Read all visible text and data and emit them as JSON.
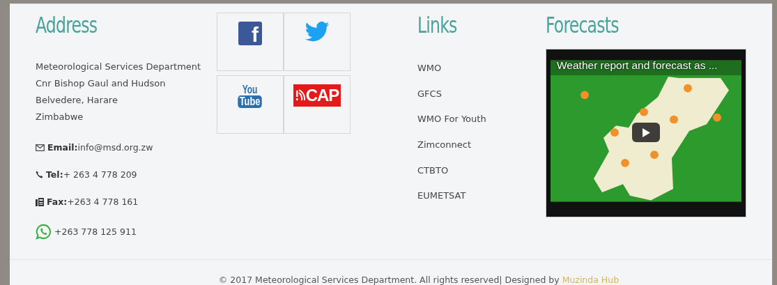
{
  "address": {
    "title": "Address",
    "lines": [
      "Meteorological Services Department",
      "Cnr Bishop Gaul and Hudson",
      "Belvedere, Harare",
      "Zimbabwe"
    ],
    "contacts": [
      {
        "kind": "email",
        "label": "Email:",
        "value": "info@msd.org.zw"
      },
      {
        "kind": "phone",
        "label": "Tel:",
        "value": "+ 263 4 778 209"
      },
      {
        "kind": "fax",
        "label": "Fax:",
        "value": "+263 4 778 161"
      },
      {
        "kind": "whatsapp",
        "value": "+263 778 125 911"
      }
    ]
  },
  "social": [
    {
      "kind": "facebook",
      "text": "f"
    },
    {
      "kind": "twitter"
    },
    {
      "kind": "youtube",
      "text": "You",
      "text2": "Tube"
    },
    {
      "kind": "cap",
      "text": "CAP"
    }
  ],
  "links": {
    "title": "Links",
    "items": [
      "WMO",
      "GFCS",
      "WMO For Youth",
      "Zimconnect",
      "CTBTO",
      "EUMETSAT"
    ]
  },
  "forecasts": {
    "title": "Forecasts",
    "video_title": "Weather report and forecast as ..."
  },
  "footer": {
    "text": "© 2017 Meteorological Services Department. All rights reserved| Designed by",
    "link": "Muzinda Hub"
  }
}
